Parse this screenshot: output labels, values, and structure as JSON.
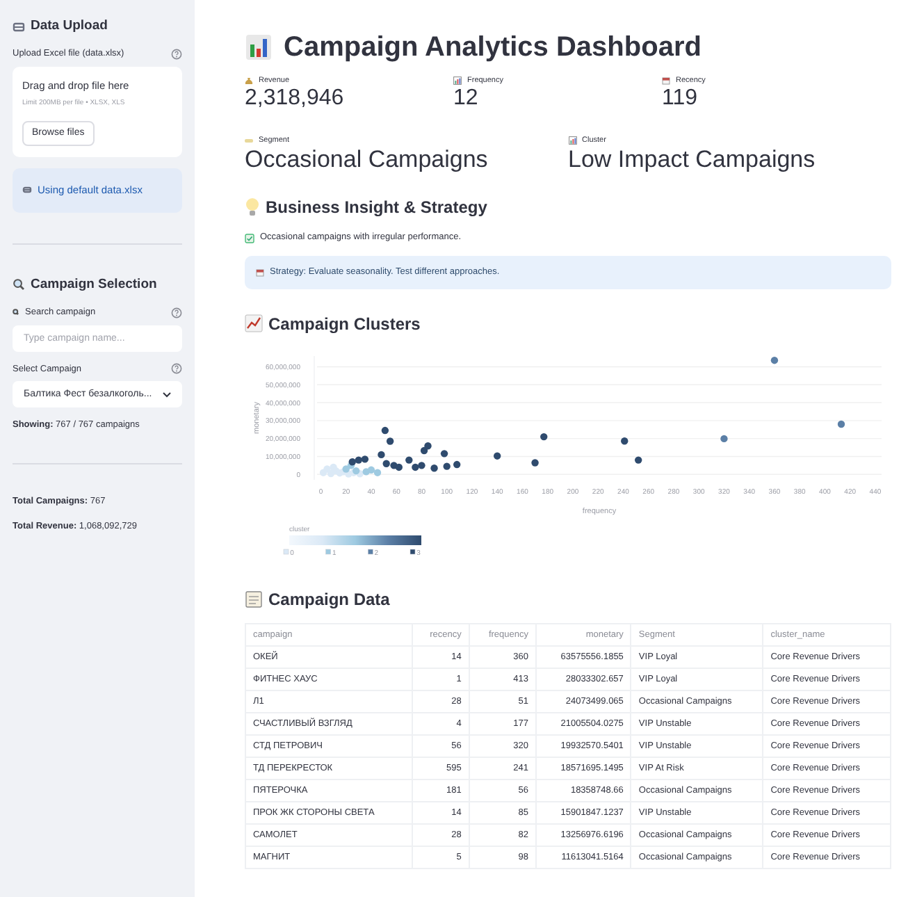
{
  "sidebar": {
    "upload": {
      "title": "Data Upload",
      "label": "Upload Excel file (data.xlsx)",
      "drop_text": "Drag and drop file here",
      "limit": "Limit 200MB per file • XLSX, XLS",
      "button": "Browse files",
      "info": "Using default data.xlsx"
    },
    "selection": {
      "title": "Campaign Selection",
      "search_label": "Search campaign",
      "search_placeholder": "Type campaign name...",
      "select_label": "Select Campaign",
      "select_value": "Балтика Фест безалкоголь...",
      "showing": "**Showing:** 767 / 767 campaigns"
    },
    "totals": [
      "**Total Campaigns:** 767",
      "**Total Revenue:** 1,068,092,729"
    ]
  },
  "title": "Campaign Analytics Dashboard",
  "metrics": [
    {
      "kind": "money",
      "label": "Revenue",
      "value": "2,318,946"
    },
    {
      "kind": "bars",
      "label": "Frequency",
      "value": "12"
    },
    {
      "kind": "calendar",
      "label": "Recency",
      "value": "119"
    }
  ],
  "labels": [
    {
      "kind": "tag",
      "label": "Segment",
      "value": "Occasional Campaigns"
    },
    {
      "kind": "bars",
      "label": "Cluster",
      "value": "Low Impact Campaigns"
    }
  ],
  "insight": {
    "title": "Business Insight & Strategy",
    "note": "Occasional campaigns with irregular performance.",
    "strategy": "Strategy: Evaluate seasonality. Test different approaches."
  },
  "clusters": {
    "title": "Campaign Clusters",
    "chart_data": {
      "type": "scatter",
      "title": "cluster",
      "xlabel": "frequency",
      "ylabel": "monetary",
      "xlim": [
        -3,
        445
      ],
      "ylim": [
        -3000000,
        66000000
      ],
      "grid": true,
      "legend": "bottom-left",
      "xticks": [
        0,
        20,
        40,
        60,
        80,
        100,
        120,
        140,
        160,
        180,
        200,
        220,
        240,
        260,
        280,
        300,
        320,
        340,
        360,
        380,
        400,
        420,
        440
      ],
      "yticks": [
        {
          "value": 0,
          "label": "0"
        },
        {
          "value": 10000000,
          "label": "10,000,000"
        },
        {
          "value": 20000000,
          "label": "20,000,000"
        },
        {
          "value": 30000000,
          "label": "30,000,000"
        },
        {
          "value": 40000000,
          "label": "40,000,000"
        },
        {
          "value": 50000000,
          "label": "50,000,000"
        },
        {
          "value": 60000000,
          "label": "60,000,000"
        }
      ],
      "x": [
        2,
        5,
        8,
        10,
        12,
        15,
        18,
        20,
        22,
        24,
        25,
        26,
        28,
        30,
        31,
        35,
        36,
        40,
        45,
        48,
        51,
        52,
        55,
        58,
        62,
        70,
        75,
        80,
        82,
        85,
        90,
        98,
        100,
        108,
        140,
        170,
        177,
        241,
        252,
        320,
        360,
        413
      ],
      "series": [
        {
          "name": "0",
          "color": "#dbe9f6",
          "values": [
            1000000,
            3000000,
            500000,
            4000000,
            2000000,
            800000,
            1500000,
            null,
            300000,
            null,
            null,
            1000000,
            null,
            null,
            400000,
            null,
            null,
            null,
            null,
            null,
            null,
            null,
            null,
            null,
            null,
            null,
            null,
            null,
            null,
            null,
            null,
            null,
            null,
            null,
            null,
            null,
            null,
            null,
            null,
            null,
            null,
            null
          ]
        },
        {
          "name": "1",
          "color": "#9ecae1",
          "values": [
            null,
            null,
            null,
            null,
            null,
            null,
            null,
            3000000,
            null,
            5000000,
            null,
            null,
            2000000,
            null,
            null,
            null,
            1500000,
            2500000,
            1000000,
            null,
            null,
            null,
            null,
            null,
            null,
            null,
            null,
            null,
            null,
            null,
            null,
            null,
            null,
            null,
            null,
            null,
            null,
            null,
            null,
            null,
            null,
            null
          ]
        },
        {
          "name": "2",
          "color": "#5b7fa6",
          "values": [
            null,
            null,
            null,
            null,
            null,
            null,
            null,
            null,
            null,
            null,
            null,
            null,
            null,
            null,
            null,
            null,
            null,
            null,
            null,
            null,
            null,
            null,
            null,
            null,
            null,
            null,
            null,
            null,
            null,
            null,
            null,
            null,
            null,
            null,
            null,
            null,
            null,
            null,
            null,
            19900000,
            63600000,
            28000000
          ]
        },
        {
          "name": "3",
          "color": "#2f4b6e",
          "values": [
            null,
            null,
            null,
            null,
            null,
            null,
            null,
            null,
            null,
            null,
            7000000,
            null,
            null,
            8000000,
            null,
            8500000,
            null,
            null,
            null,
            11000000,
            24500000,
            6000000,
            18500000,
            5000000,
            4000000,
            8000000,
            4000000,
            5000000,
            13300000,
            15900000,
            3500000,
            11600000,
            4500000,
            5500000,
            10300000,
            6500000,
            21000000,
            18600000,
            8000000,
            null,
            null,
            null
          ]
        }
      ]
    }
  },
  "table": {
    "title": "Campaign Data",
    "columns": [
      {
        "label": "campaign",
        "numeric": false
      },
      {
        "label": "recency",
        "numeric": true
      },
      {
        "label": "frequency",
        "numeric": true
      },
      {
        "label": "monetary",
        "numeric": true
      },
      {
        "label": "Segment",
        "numeric": false
      },
      {
        "label": "cluster_name",
        "numeric": false
      }
    ],
    "rows": [
      [
        "ОКЕЙ",
        "14",
        "360",
        "63575556.1855",
        "VIP Loyal",
        "Core Revenue Drivers"
      ],
      [
        "ФИТНЕС ХАУС",
        "1",
        "413",
        "28033302.657",
        "VIP Loyal",
        "Core Revenue Drivers"
      ],
      [
        "Л1",
        "28",
        "51",
        "24073499.065",
        "Occasional Campaigns",
        "Core Revenue Drivers"
      ],
      [
        "СЧАСТЛИВЫЙ ВЗГЛЯД",
        "4",
        "177",
        "21005504.0275",
        "VIP Unstable",
        "Core Revenue Drivers"
      ],
      [
        "СТД ПЕТРОВИЧ",
        "56",
        "320",
        "19932570.5401",
        "VIP Unstable",
        "Core Revenue Drivers"
      ],
      [
        "ТД ПЕРЕКРЕСТОК",
        "595",
        "241",
        "18571695.1495",
        "VIP At Risk",
        "Core Revenue Drivers"
      ],
      [
        "ПЯТЕРОЧКА",
        "181",
        "56",
        "18358748.66",
        "Occasional Campaigns",
        "Core Revenue Drivers"
      ],
      [
        "ПРОК ЖК СТОРОНЫ СВЕТА",
        "14",
        "85",
        "15901847.1237",
        "VIP Unstable",
        "Core Revenue Drivers"
      ],
      [
        "САМОЛЕТ",
        "28",
        "82",
        "13256976.6196",
        "Occasional Campaigns",
        "Core Revenue Drivers"
      ],
      [
        "МАГНИТ",
        "5",
        "98",
        "11613041.5164",
        "Occasional Campaigns",
        "Core Revenue Drivers"
      ]
    ]
  }
}
